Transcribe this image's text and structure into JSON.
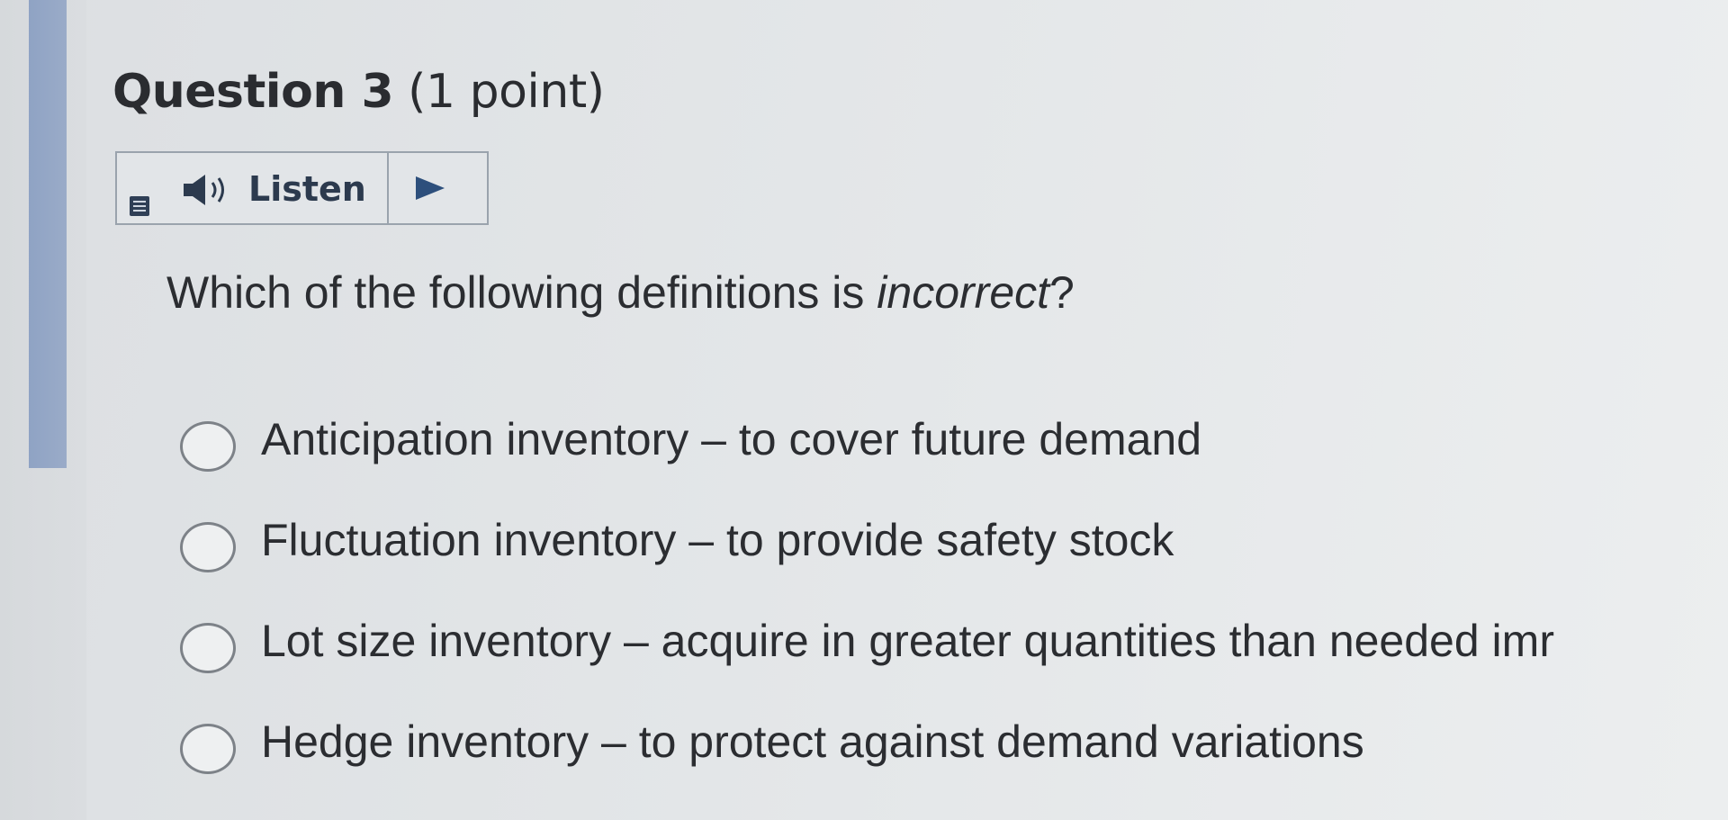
{
  "question": {
    "label": "Question 3",
    "points": " (1 point)",
    "text_before": "Which of the following definitions is ",
    "text_emphasis": "incorrect",
    "text_after": "?"
  },
  "listen": {
    "label": "Listen",
    "icons": [
      "menu-icon",
      "speaker-icon",
      "play-icon"
    ]
  },
  "options": [
    {
      "label": "Anticipation inventory – to cover future demand",
      "selected": false
    },
    {
      "label": "Fluctuation inventory – to provide safety stock",
      "selected": false
    },
    {
      "label": "Lot size inventory – acquire in greater quantities than needed imr",
      "selected": false
    },
    {
      "label": "Hedge inventory – to protect against demand variations",
      "selected": false
    }
  ],
  "colors": {
    "accent_bar": "#9aabc8",
    "play_icon": "#2d4f7c",
    "listen_text": "#2c3a4e"
  }
}
